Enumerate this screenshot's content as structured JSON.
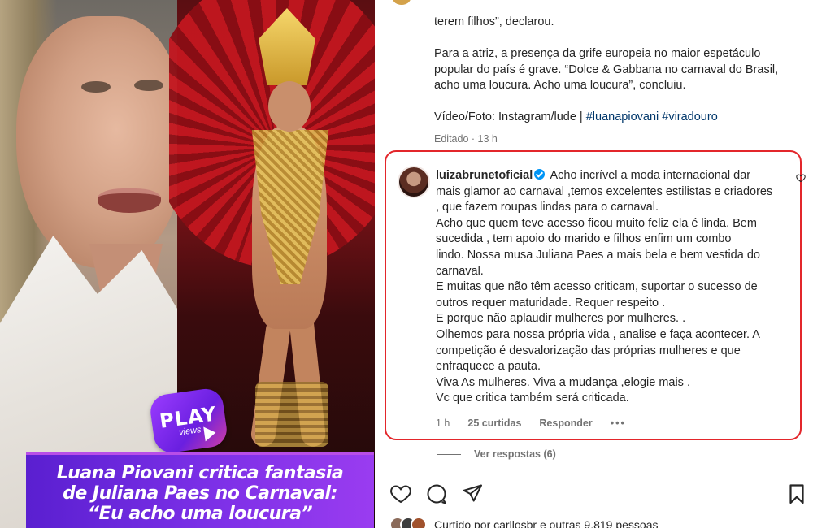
{
  "media": {
    "badge": {
      "title": "PLAY",
      "subtitle": "views"
    },
    "headline": [
      "Luana Piovani critica fantasia",
      "de Juliana Paes no Carnaval:",
      "“Eu acho uma loucura”"
    ]
  },
  "caption": {
    "line1": "terem filhos”, declarou.",
    "para2": [
      "Para a atriz, a presença da grife europeia no maior espetáculo",
      "popular do país é grave. “Dolce & Gabbana no carnaval do Brasil,",
      "acho uma loucura. Acho uma loucura”, concluiu."
    ],
    "credit_prefix": "Vídeo/Foto: Instagram/lude | ",
    "hashtags": "#luanapiovani #viradouro",
    "edited": "Editado · 13 h"
  },
  "comment": {
    "username": "luizabrunetoficial",
    "lines": [
      "Acho incrível a moda internacional dar",
      "mais glamor ao carnaval ,temos excelentes estilistas e criadores",
      ", que fazem roupas lindas para o carnaval.",
      "Acho que quem teve acesso ficou muito feliz ela é linda. Bem",
      "sucedida , tem apoio do marido e filhos enfim um combo",
      "lindo. Nossa musa Juliana Paes a mais bela e bem vestida do",
      "carnaval.",
      "E muitas que não têm acesso criticam, suportar o sucesso de",
      "outros requer maturidade. Requer respeito .",
      "E porque não aplaudir mulheres por mulheres. .",
      "Olhemos para nossa própria vida , analise e faça acontecer. A",
      "competição é desvalorização das próprias mulheres e que",
      "enfraquece a pauta.",
      "Viva As mulheres. Viva a mudança ,elogie mais .",
      "Vc que critica também será criticada."
    ],
    "time": "1 h",
    "likes": "25 curtidas",
    "reply": "Responder",
    "more": "•••",
    "view_replies": "Ver respostas (6)"
  },
  "likes_bar": {
    "text": "Curtido por carllosbr e outras 9.819 pessoas"
  },
  "icons": {
    "like": "heart-icon",
    "comment": "comment-icon",
    "share": "send-icon",
    "save": "bookmark-icon"
  },
  "colors": {
    "highlight_border": "#e3262b",
    "hashtag": "#00376b",
    "verified": "#0095f6",
    "headline_bg": "#7a2fe6"
  }
}
